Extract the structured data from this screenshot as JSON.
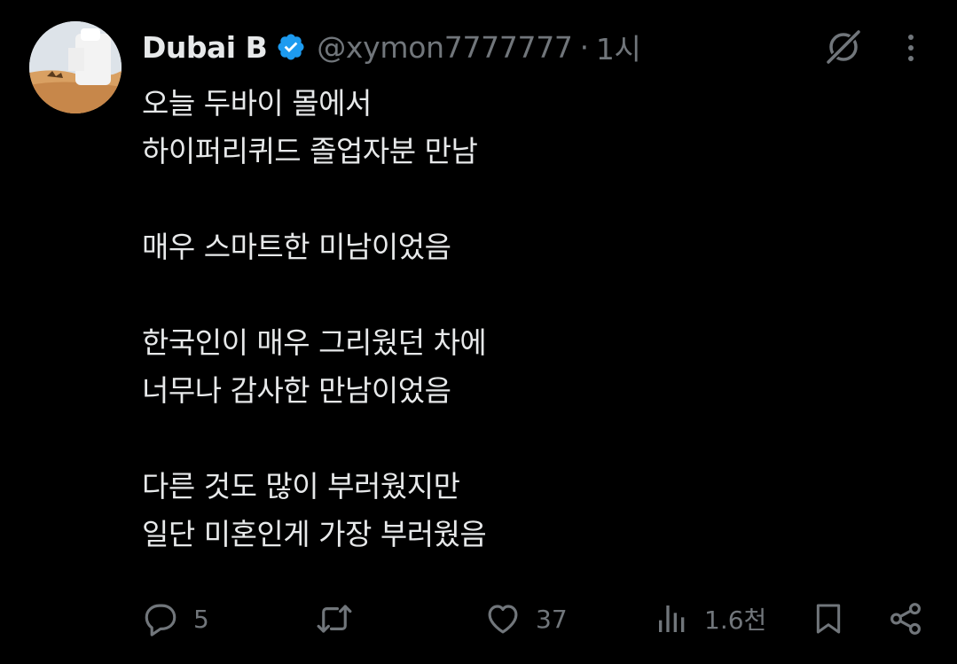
{
  "author": {
    "display_name": "Dubai B",
    "verified_icon": "verified-badge-icon",
    "handle": "@xymon7777777",
    "separator": "·",
    "time": "1시"
  },
  "header_icons": {
    "grok": "grok-icon",
    "more": "more-options-icon"
  },
  "tweet": {
    "text": "오늘 두바이 몰에서\n하이퍼리퀴드 졸업자분 만남\n\n매우 스마트한 미남이었음\n\n한국인이 매우 그리웠던 차에\n너무나 감사한 만남이었음\n\n다른 것도 많이 부러웠지만\n일단 미혼인게 가장 부러웠음"
  },
  "actions": {
    "reply": {
      "icon": "reply-icon",
      "count": "5"
    },
    "retweet": {
      "icon": "retweet-icon",
      "count": ""
    },
    "like": {
      "icon": "heart-icon",
      "count": "37"
    },
    "views": {
      "icon": "views-icon",
      "count": "1.6천"
    },
    "bookmark": {
      "icon": "bookmark-icon"
    },
    "share": {
      "icon": "share-icon"
    }
  },
  "colors": {
    "background": "#000000",
    "text": "#e7e9ea",
    "muted": "#71767b",
    "verified": "#1d9bf0"
  }
}
